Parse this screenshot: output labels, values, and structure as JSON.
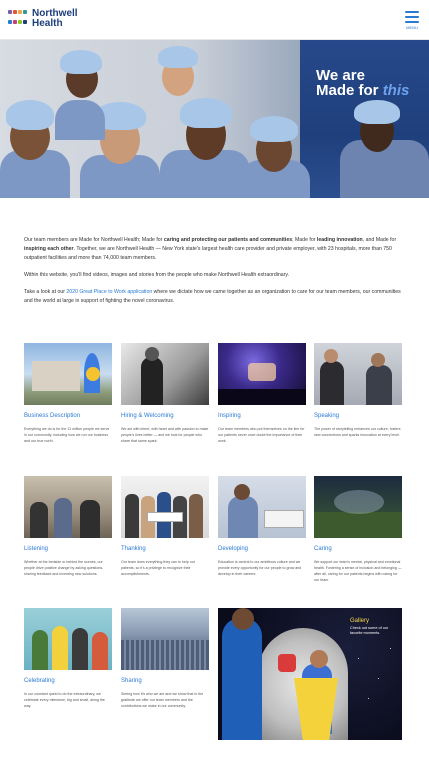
{
  "header": {
    "logo_line1": "Northwell",
    "logo_line2": "Health",
    "logo_colors": [
      "#7b5ea7",
      "#e4572e",
      "#f2a541",
      "#2a9d8f",
      "#2a7ad1",
      "#c73e7a",
      "#8ac926",
      "#1c3f7a"
    ],
    "menu_icon": "hamburger-menu-icon",
    "menu_label": "MENU"
  },
  "hero": {
    "tagline_line1": "We are",
    "tagline_line2": "Made for",
    "tagline_accent": "this"
  },
  "intro": {
    "p1_a": "Our team members are Made for Northwell Health; Made for ",
    "p1_b": "caring and protecting our patients and communities",
    "p1_c": "; Made for ",
    "p1_d": "leading innovation",
    "p1_e": ", and Made for ",
    "p1_f": "inspiring each other",
    "p1_g": ". Together, we are Northwell Health — New York state's largest health care provider and private employer, with 23 hospitals, more than 750 outpatient facilities and more than 74,000 team members.",
    "p2": "Within this website, you'll find videos, images and stories from the people who make Northwell Health extraordinary.",
    "p3_a": "Take a look at our ",
    "p3_link": "2020 Great Place to Work application",
    "p3_b": " where we dictate how we came together as an organization to care for our team members, our communities and the world at large in support of fighting the novel coronavirus."
  },
  "cards": [
    {
      "title": "Business Description",
      "desc": "Everything we do is for the 11 million people we serve in our community, including how we run our business and our true north."
    },
    {
      "title": "Hiring & Welcoming",
      "desc": "We act with intent, with heart and with passion to make people's lives better — and we look for people who share that same spark."
    },
    {
      "title": "Inspiring",
      "desc": "Our team members who put themselves on the line for our patients never once doubt the importance of their work."
    },
    {
      "title": "Speaking",
      "desc": "The power of storytelling enhances our culture, fosters new connections and sparks innovation at every level."
    },
    {
      "title": "Listening",
      "desc": "Whether at the bedside or behind the scenes, our people drive positive change by asking questions, sharing feedback and inventing new solutions."
    },
    {
      "title": "Thanking",
      "desc": "Our team does everything they can to help our patients, so it's a privilege to recognize their accomplishments."
    },
    {
      "title": "Developing",
      "desc": "Education is central to our ambitious culture and we provide every opportunity for our people to grow and develop in their careers."
    },
    {
      "title": "Caring",
      "desc": "We support our team's mental, physical and emotional health. Fostering a sense of inclusion and belonging — after all, caring for our patients begins with caring for our team."
    },
    {
      "title": "Celebrating",
      "desc": "In our constant quest to do the extraordinary, we celebrate every milestone, big and small, along the way."
    },
    {
      "title": "Sharing",
      "desc": "Seeing how it's who we are and we show that in the gratitude we offer our team members and the contributions we make in our community."
    }
  ],
  "feature": {
    "label": "Gallery",
    "text": "Check out some of our favorite moments."
  }
}
